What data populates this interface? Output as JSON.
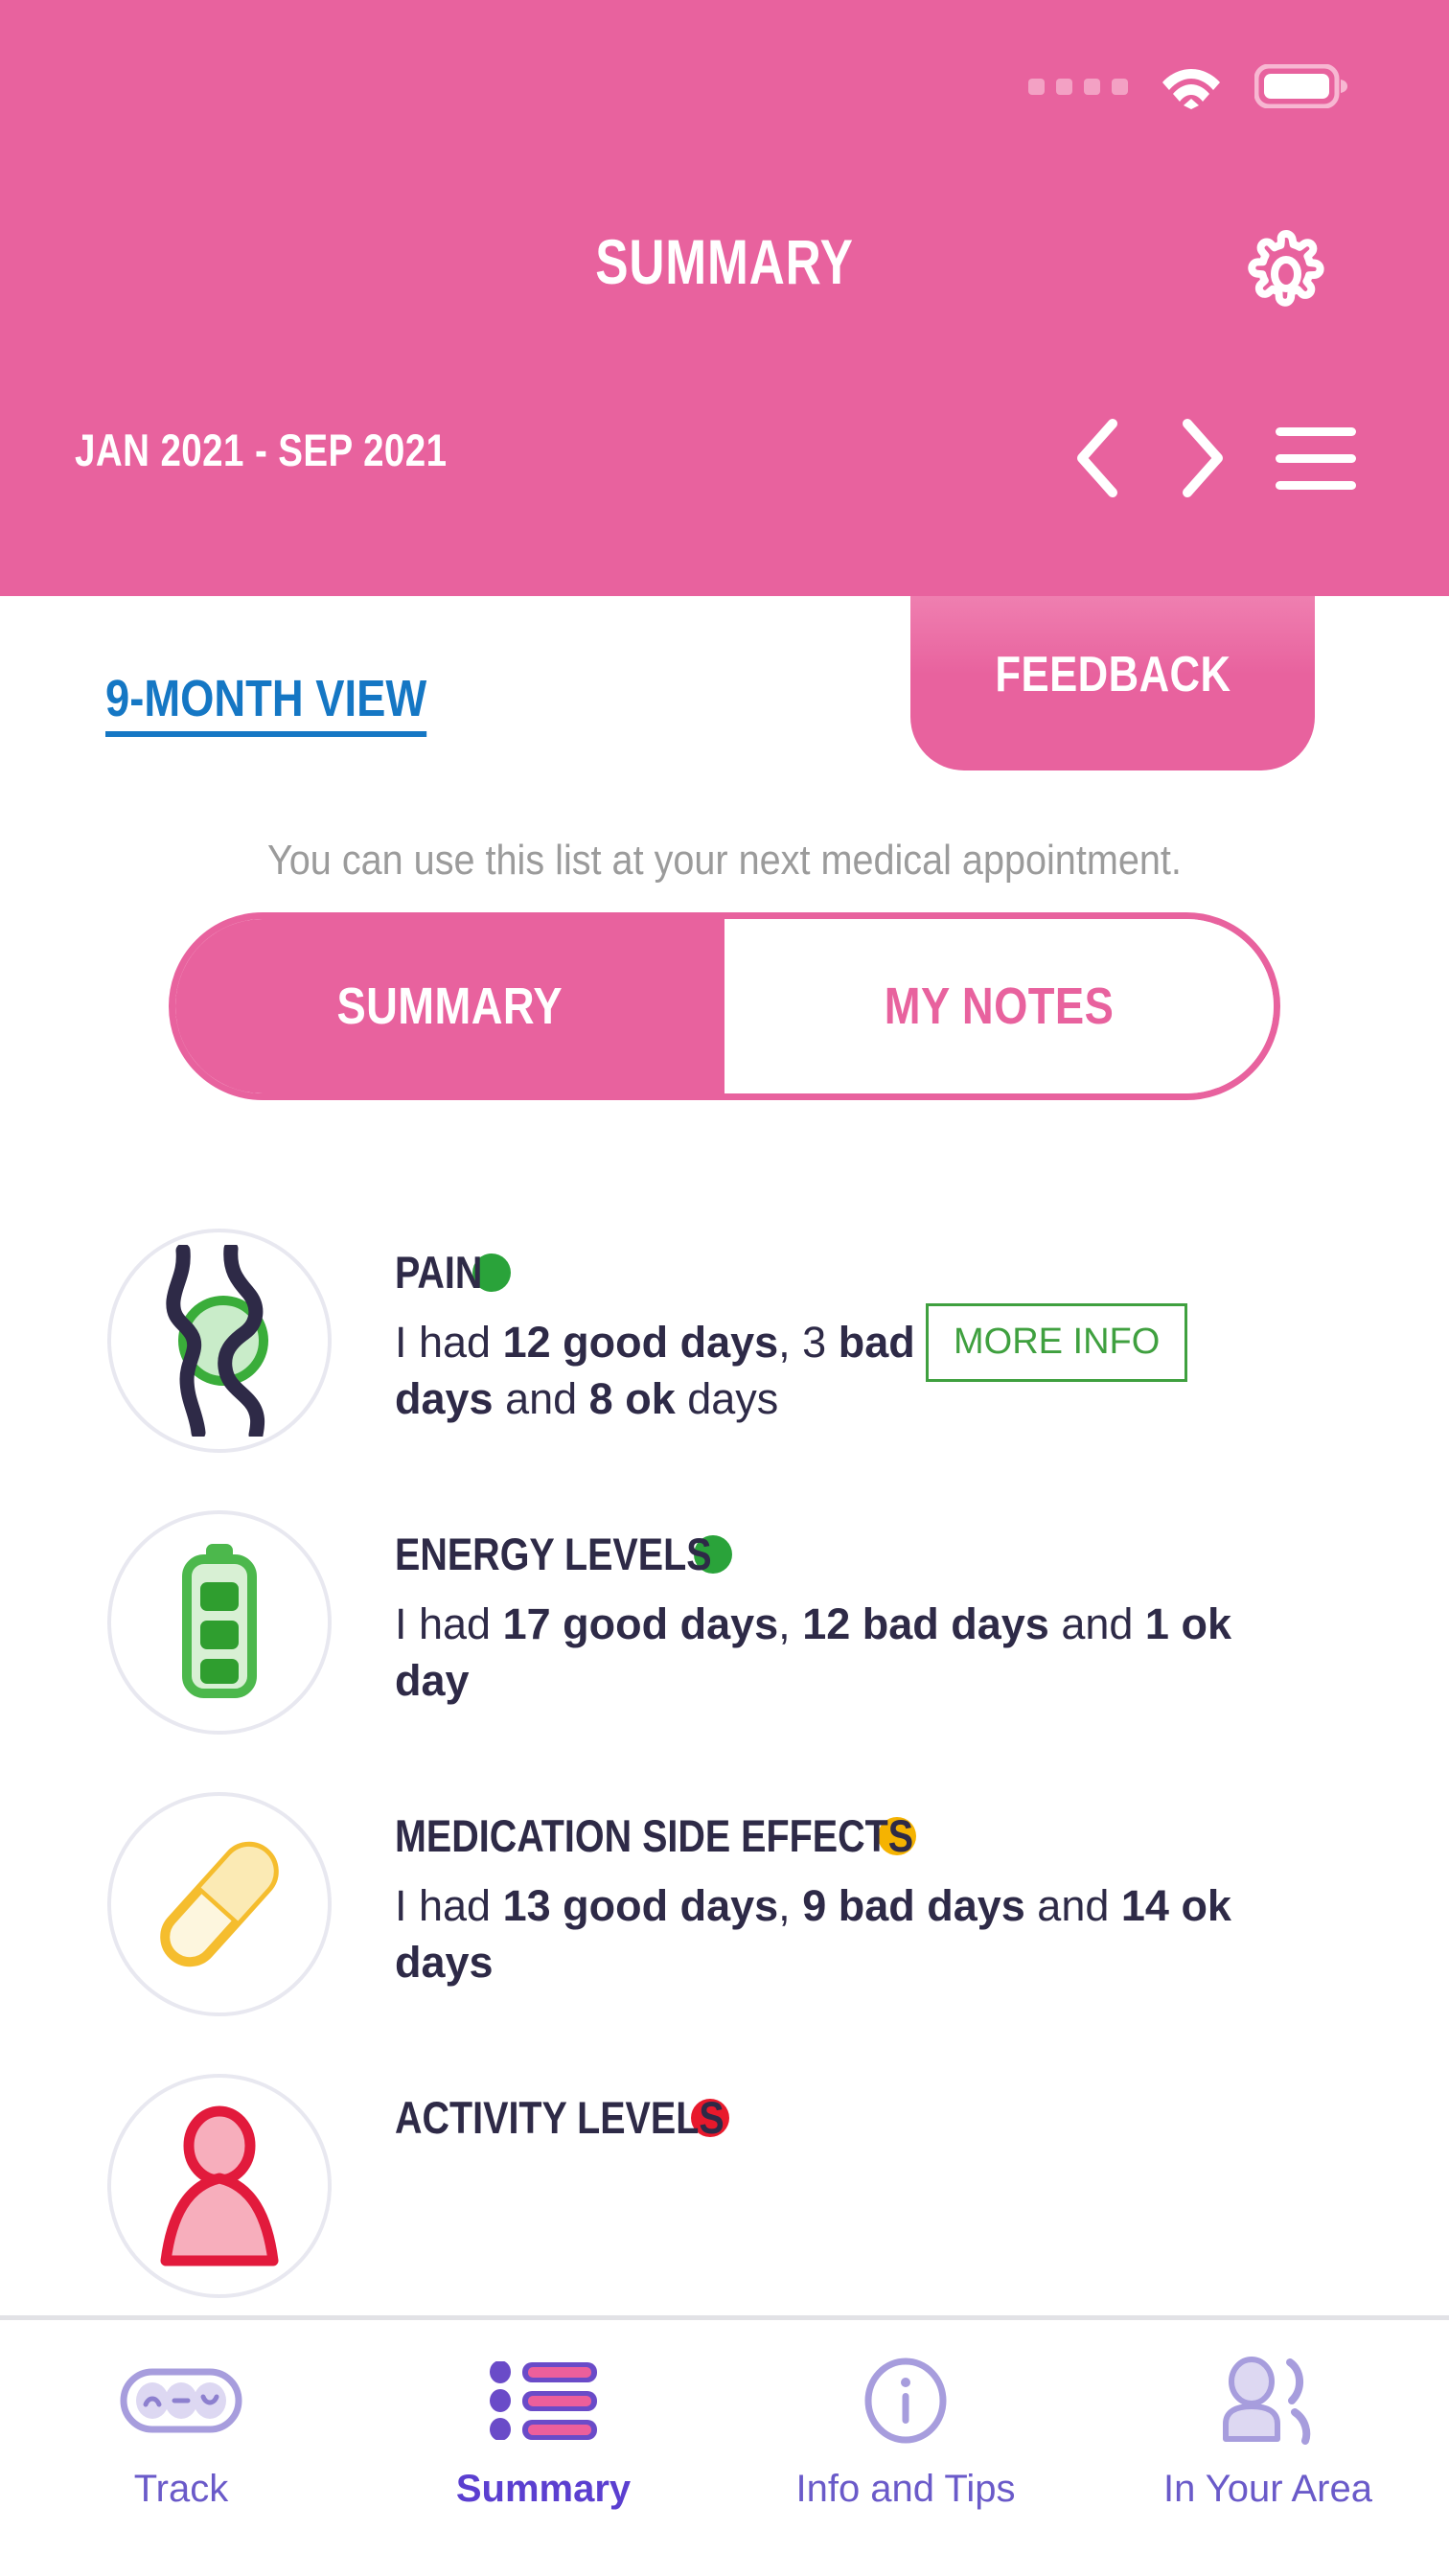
{
  "theme": {
    "pink": "#e8629e",
    "blue_link": "#1577c4",
    "navy_text": "#2e2a47",
    "green": "#3fa03f",
    "amber": "#f5b301",
    "red": "#e8192c",
    "nav_purple": "#6a5ac9",
    "nav_active_purple": "#5b3fd0",
    "icon_ring": "#e8e8f0"
  },
  "status_bar": {
    "signal_icon": "signal-dots-icon",
    "wifi_icon": "wifi-icon",
    "battery_icon": "battery-full-icon"
  },
  "header": {
    "title": "SUMMARY",
    "settings_icon": "gear-icon",
    "date_range": "JAN 2021 - SEP 2021",
    "prev_icon": "chevron-left-icon",
    "next_icon": "chevron-right-icon",
    "menu_icon": "hamburger-menu-icon"
  },
  "feedback_tab": {
    "label": "FEEDBACK"
  },
  "content": {
    "view_link": "9-MONTH VIEW",
    "subtitle": "You can use this list at your next medical appointment.",
    "toggle": {
      "options": [
        {
          "label": "SUMMARY",
          "active": true
        },
        {
          "label": "MY NOTES",
          "active": false
        }
      ]
    }
  },
  "summary_rows": [
    {
      "title": "PAIN",
      "icon": "joint-pain-icon",
      "status_color": "#2aa33a",
      "status_label": "green",
      "text_parts": [
        {
          "t": "I had ",
          "bold": false
        },
        {
          "t": "12 good days",
          "bold": true
        },
        {
          "t": ", 3 ",
          "bold": false
        },
        {
          "t": "bad days",
          "bold": true
        },
        {
          "t": " and ",
          "bold": false
        },
        {
          "t": "8 ok",
          "bold": true
        },
        {
          "t": " days",
          "bold": false
        }
      ],
      "full_text": "I had 12 good days, 3 bad days and 8 ok days",
      "good_days": 12,
      "bad_days": 3,
      "ok_days": 8,
      "more_info_label": "MORE INFO"
    },
    {
      "title": "ENERGY LEVELS",
      "icon": "battery-level-icon",
      "status_color": "#2aa33a",
      "status_label": "green",
      "text_parts": [
        {
          "t": "I had ",
          "bold": false
        },
        {
          "t": "17 good days",
          "bold": true
        },
        {
          "t": ", ",
          "bold": false
        },
        {
          "t": "12 bad days",
          "bold": true
        },
        {
          "t": " and ",
          "bold": false
        },
        {
          "t": "1 ok day",
          "bold": true
        }
      ],
      "full_text": "I had 17 good days, 12 bad days and 1 ok day",
      "good_days": 17,
      "bad_days": 12,
      "ok_days": 1,
      "more_info_label": null
    },
    {
      "title": "MEDICATION SIDE EFFECTS",
      "icon": "pill-capsule-icon",
      "status_color": "#f5b301",
      "status_label": "amber",
      "text_parts": [
        {
          "t": "I had ",
          "bold": false
        },
        {
          "t": "13 good days",
          "bold": true
        },
        {
          "t": ", ",
          "bold": false
        },
        {
          "t": "9 bad days",
          "bold": true
        },
        {
          "t": " and ",
          "bold": false
        },
        {
          "t": "14 ok days",
          "bold": true
        }
      ],
      "full_text": "I had 13 good days, 9 bad days and 14 ok days",
      "good_days": 13,
      "bad_days": 9,
      "ok_days": 14,
      "more_info_label": null
    },
    {
      "title": "ACTIVITY LEVELS",
      "icon": "person-activity-icon",
      "status_color": "#e8192c",
      "status_label": "red",
      "text_parts": [],
      "full_text": "",
      "more_info_label": null
    }
  ],
  "bottom_nav": [
    {
      "label": "Track",
      "icon": "mood-tracker-icon",
      "active": false
    },
    {
      "label": "Summary",
      "icon": "list-summary-icon",
      "active": true
    },
    {
      "label": "Info and Tips",
      "icon": "info-circle-icon",
      "active": false
    },
    {
      "label": "In Your Area",
      "icon": "person-signal-icon",
      "active": false
    }
  ]
}
